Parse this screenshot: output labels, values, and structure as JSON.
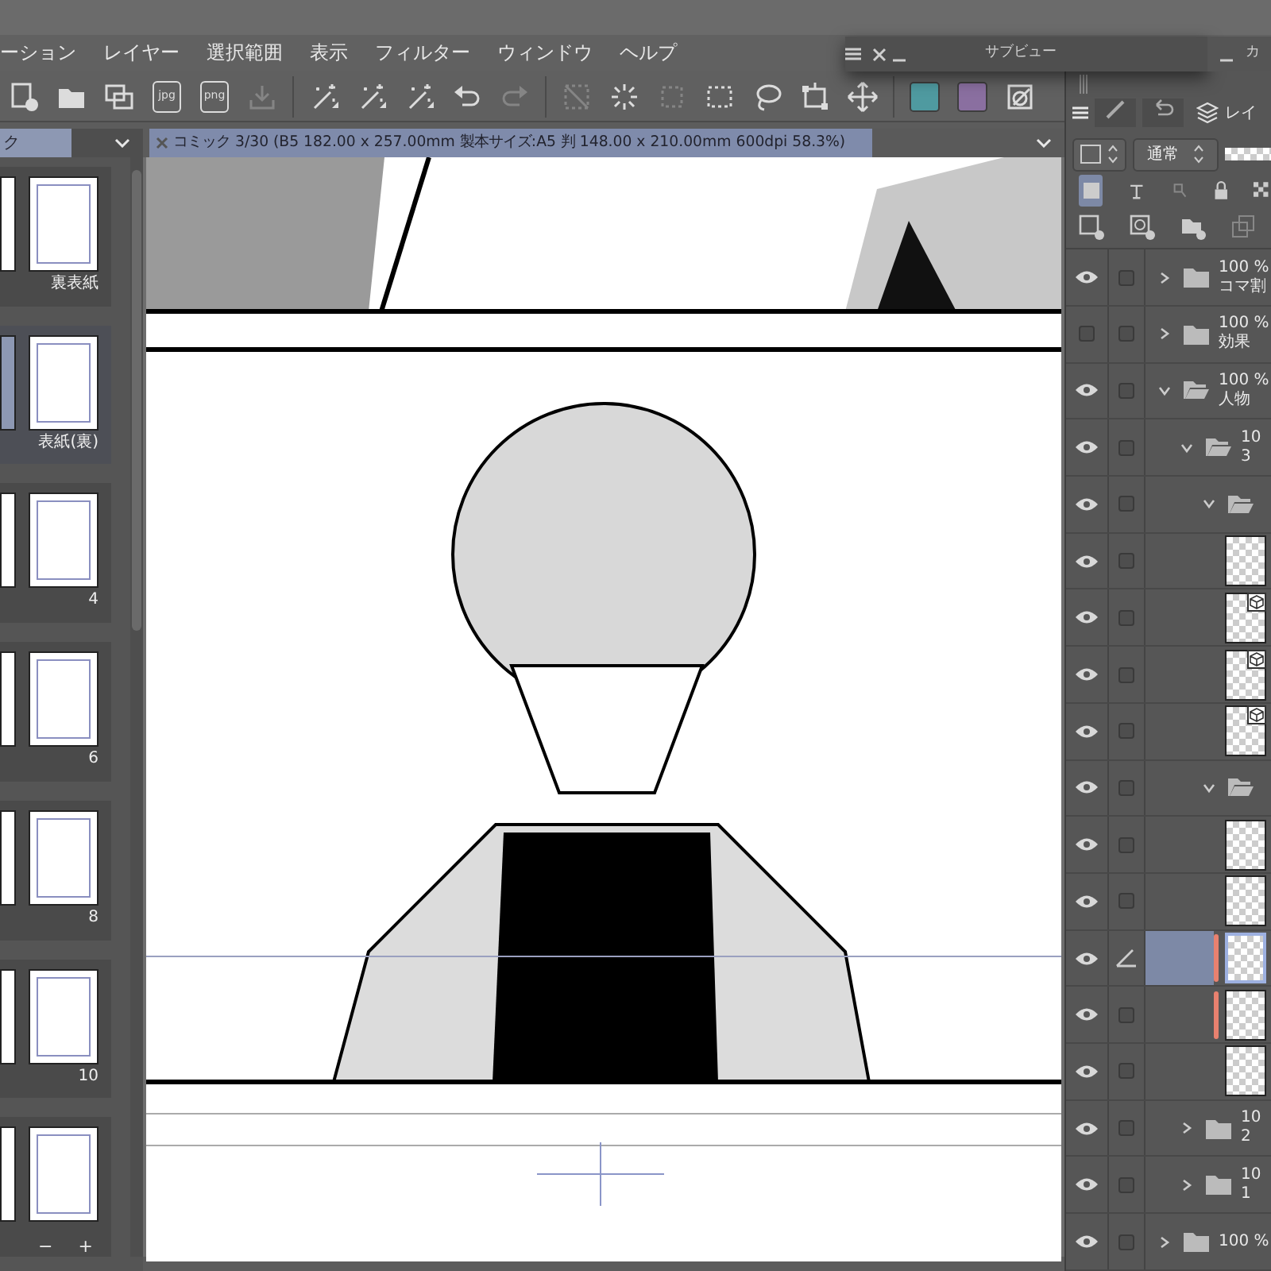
{
  "menu": [
    "ーション",
    "レイヤー",
    "選択範囲",
    "表示",
    "フィルター",
    "ウィンドウ",
    "ヘルプ"
  ],
  "subview": {
    "title": "サブビュー",
    "next_title": "カ"
  },
  "toolbar": [
    {
      "kind": "new",
      "disabled": false
    },
    {
      "kind": "open",
      "disabled": false
    },
    {
      "kind": "import",
      "disabled": false
    },
    {
      "kind": "export-file",
      "label": "jpg",
      "disabled": false
    },
    {
      "kind": "export-file",
      "label": "png",
      "disabled": false
    },
    {
      "kind": "upload",
      "disabled": true
    },
    {
      "kind": "separator"
    },
    {
      "kind": "wand",
      "disabled": false
    },
    {
      "kind": "wand",
      "disabled": false
    },
    {
      "kind": "wand",
      "disabled": false
    },
    {
      "kind": "undo",
      "disabled": false
    },
    {
      "kind": "redo",
      "disabled": true
    },
    {
      "kind": "separator"
    },
    {
      "kind": "clear-selection",
      "disabled": true
    },
    {
      "kind": "spinner",
      "disabled": false
    },
    {
      "kind": "crop",
      "disabled": true
    },
    {
      "kind": "rect-select",
      "disabled": false
    },
    {
      "kind": "lasso",
      "disabled": false
    },
    {
      "kind": "transform",
      "disabled": false
    },
    {
      "kind": "move",
      "disabled": false
    },
    {
      "kind": "separator"
    },
    {
      "kind": "swatch",
      "color": "#4f9aa0",
      "disabled": false
    },
    {
      "kind": "swatch",
      "color": "#8a6fa0",
      "disabled": false
    },
    {
      "kind": "image",
      "disabled": false
    }
  ],
  "page_panel": {
    "title": "ク",
    "zoom_out": "−",
    "zoom_in": "+",
    "pages": [
      {
        "label": "裏表紙",
        "selected": false
      },
      {
        "label": "表紙(裏)",
        "selected": true
      },
      {
        "label": "4",
        "selected": false
      },
      {
        "label": "6",
        "selected": false
      },
      {
        "label": "8",
        "selected": false
      },
      {
        "label": "10",
        "selected": false
      },
      {
        "selected": false
      }
    ]
  },
  "canvas": {
    "tab_title": "コミック 3/30 (B5 182.00 x 257.00mm 製本サイズ:A5 判 148.00 x 210.00mm 600dpi 58.3%)"
  },
  "layer_panel": {
    "tab_label": "レイ",
    "blend_mode": "通常",
    "opacity": {
      "level": 1
    },
    "layers": [
      {
        "kind": "folder",
        "opacity": "100 %",
        "name": "コマ割",
        "expanded": false,
        "visible": true,
        "selected": false,
        "flagged": false
      },
      {
        "kind": "folder",
        "opacity": "100 %",
        "name": "効果",
        "expanded": false,
        "visible": false,
        "selected": false,
        "flagged": false
      },
      {
        "kind": "folder",
        "opacity": "100 %",
        "name": "人物",
        "expanded": true,
        "visible": true,
        "selected": false,
        "flagged": false,
        "children": [
          {
            "kind": "folder",
            "opacity": "10",
            "name": "3",
            "expanded": true,
            "visible": true,
            "selected": false,
            "flagged": false,
            "children": [
              {
                "kind": "folder",
                "expanded": true,
                "visible": true,
                "selected": false,
                "flagged": false,
                "children": [
                  {
                    "kind": "layer",
                    "visible": true,
                    "selected": false,
                    "flagged": false
                  },
                  {
                    "kind": "model",
                    "visible": true,
                    "selected": false,
                    "flagged": false
                  },
                  {
                    "kind": "model",
                    "visible": true,
                    "selected": false,
                    "flagged": false
                  },
                  {
                    "kind": "model",
                    "visible": true,
                    "selected": false,
                    "flagged": false
                  }
                ]
              },
              {
                "kind": "folder",
                "expanded": true,
                "visible": true,
                "selected": false,
                "flagged": false,
                "children": [
                  {
                    "kind": "layer",
                    "visible": true,
                    "selected": false,
                    "flagged": false
                  },
                  {
                    "kind": "layer",
                    "visible": true,
                    "selected": false,
                    "flagged": false
                  },
                  {
                    "kind": "layer",
                    "visible": true,
                    "selected": true,
                    "flagged": true
                  },
                  {
                    "kind": "layer",
                    "visible": true,
                    "selected": false,
                    "flagged": true
                  },
                  {
                    "kind": "layer",
                    "visible": true,
                    "selected": false,
                    "flagged": false
                  }
                ]
              }
            ]
          },
          {
            "kind": "folder",
            "opacity": "10",
            "name": "2",
            "expanded": false,
            "visible": true,
            "selected": false,
            "flagged": false
          },
          {
            "kind": "folder",
            "opacity": "10",
            "name": "1",
            "expanded": false,
            "visible": true,
            "selected": false,
            "flagged": false
          }
        ]
      },
      {
        "kind": "folder",
        "opacity": "100 %",
        "expanded": false,
        "visible": true,
        "selected": false,
        "flagged": false
      }
    ]
  }
}
